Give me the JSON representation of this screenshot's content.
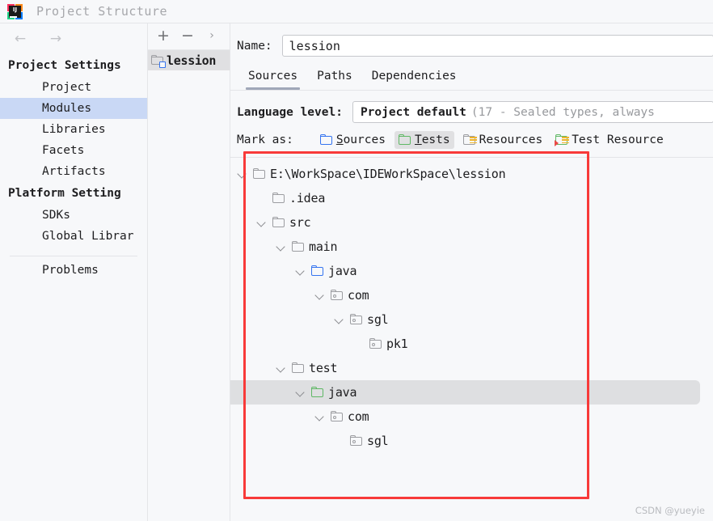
{
  "window": {
    "title": "Project Structure",
    "app_icon": "intellij-idea-logo",
    "logo_text": "IJ"
  },
  "nav": {
    "back_icon": "←",
    "forward_icon": "→",
    "groups": [
      {
        "title": "Project Settings",
        "items": [
          {
            "label": "Project",
            "selected": false
          },
          {
            "label": "Modules",
            "selected": true
          },
          {
            "label": "Libraries",
            "selected": false
          },
          {
            "label": "Facets",
            "selected": false
          },
          {
            "label": "Artifacts",
            "selected": false
          }
        ]
      },
      {
        "title": "Platform Setting",
        "items": [
          {
            "label": "SDKs",
            "selected": false
          },
          {
            "label": "Global Librar",
            "selected": false
          }
        ]
      }
    ],
    "footer_item": "Problems"
  },
  "modules_panel": {
    "toolbar": {
      "add_label": "+",
      "remove_label": "−",
      "more_label": "›"
    },
    "items": [
      {
        "label": "lession",
        "icon": "module-folder-icon",
        "selected": true
      }
    ]
  },
  "content": {
    "name_label": "Name:",
    "name_value": "lession",
    "tabs": [
      {
        "label": "Sources",
        "active": true
      },
      {
        "label": "Paths",
        "active": false
      },
      {
        "label": "Dependencies",
        "active": false
      }
    ],
    "language_level_label": "Language level:",
    "language_level_value_main": "Project default",
    "language_level_value_dim": "(17 - Sealed types, always",
    "mark_as_label": "Mark as:",
    "mark_as_options": [
      {
        "label": "Sources",
        "mnemonic": "S",
        "rest": "ources",
        "icon": "folder-blue-icon",
        "active": false
      },
      {
        "label": "Tests",
        "mnemonic": "T",
        "rest": "ests",
        "icon": "folder-green-icon",
        "active": true
      },
      {
        "label": "Resources",
        "mnemonic": "",
        "rest": "Resources",
        "icon": "resources-folder-icon",
        "active": false
      },
      {
        "label": "Test Resource",
        "mnemonic": "",
        "rest": "Test Resource",
        "icon": "test-resources-folder-icon",
        "active": false
      }
    ],
    "tree": [
      {
        "label": "E:\\WorkSpace\\IDEWorkSpace\\lession",
        "depth": 0,
        "twisty": "open",
        "icon": "folder-icon",
        "selected": false
      },
      {
        "label": ".idea",
        "depth": 1,
        "twisty": "none",
        "icon": "folder-icon",
        "selected": false
      },
      {
        "label": "src",
        "depth": 1,
        "twisty": "open",
        "icon": "folder-icon",
        "selected": false
      },
      {
        "label": "main",
        "depth": 2,
        "twisty": "open",
        "icon": "folder-icon",
        "selected": false
      },
      {
        "label": "java",
        "depth": 3,
        "twisty": "open",
        "icon": "folder-blue-icon",
        "selected": false
      },
      {
        "label": "com",
        "depth": 4,
        "twisty": "open",
        "icon": "package-icon",
        "selected": false
      },
      {
        "label": "sgl",
        "depth": 5,
        "twisty": "open",
        "icon": "package-icon",
        "selected": false
      },
      {
        "label": "pk1",
        "depth": 6,
        "twisty": "none",
        "icon": "package-icon",
        "selected": false
      },
      {
        "label": "test",
        "depth": 2,
        "twisty": "open",
        "icon": "folder-icon",
        "selected": false
      },
      {
        "label": "java",
        "depth": 3,
        "twisty": "open",
        "icon": "folder-green-icon",
        "selected": true
      },
      {
        "label": "com",
        "depth": 4,
        "twisty": "open",
        "icon": "package-icon",
        "selected": false
      },
      {
        "label": "sgl",
        "depth": 5,
        "twisty": "none",
        "icon": "package-icon",
        "selected": false
      }
    ]
  },
  "annotation": {
    "highlight_color": "#f83a39",
    "watermark": "CSDN @yueyie"
  },
  "colors": {
    "selection_blue": "#c9d8f5",
    "selection_gray": "#dedfe1",
    "accent_blue": "#3574f0",
    "accent_green": "#5fb865",
    "background": "#f7f8fa"
  }
}
